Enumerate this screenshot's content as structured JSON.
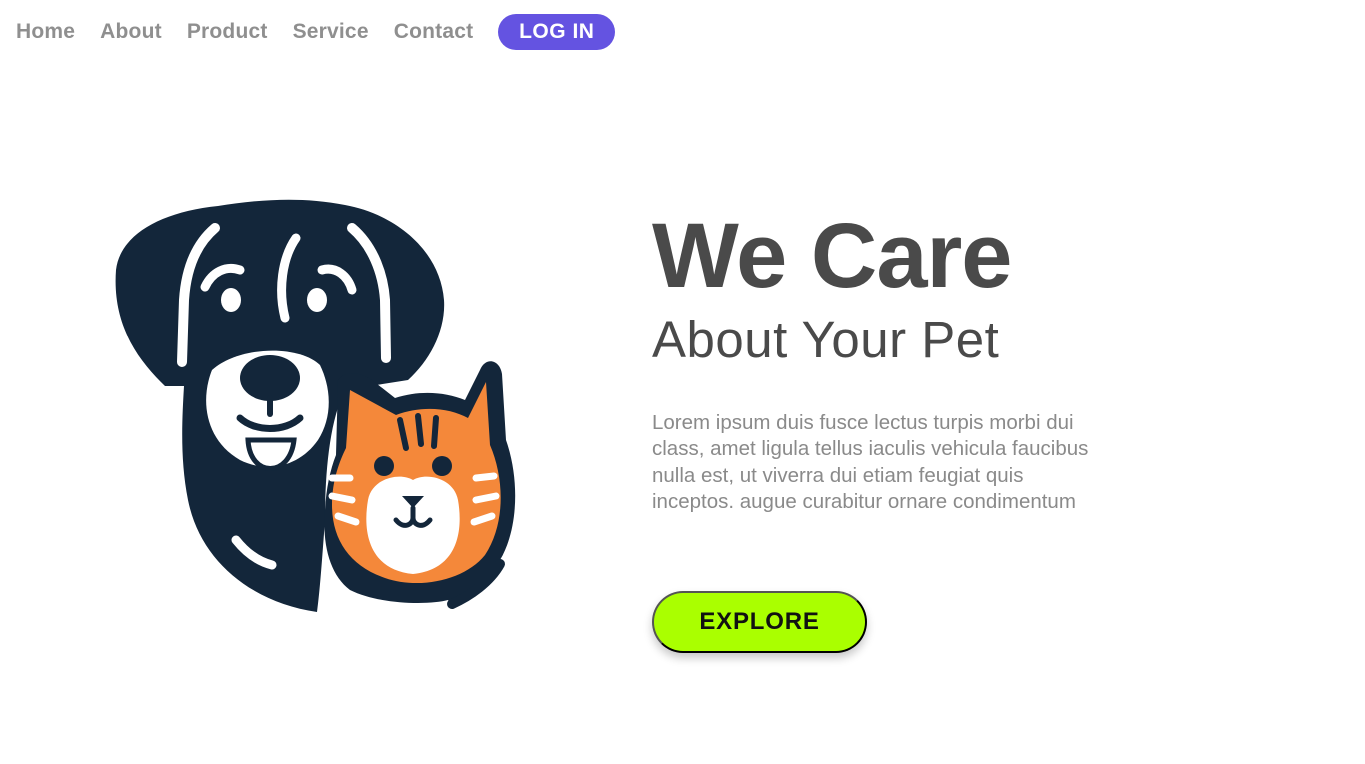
{
  "nav": {
    "links": [
      "Home",
      "About",
      "Product",
      "Service",
      "Contact"
    ],
    "login_label": "LOG IN"
  },
  "hero": {
    "headline": "We Care",
    "subheadline": "About Your Pet",
    "body": "Lorem ipsum duis fusce lectus turpis morbi dui class, amet ligula tellus iaculis vehicula faucibus nulla est, ut viverra dui etiam feugiat quis inceptos. augue curabitur ornare condimentum",
    "cta_label": "EXPLORE",
    "illustration_icon": "dog-and-cat-icon"
  },
  "colors": {
    "accent_purple": "#6453e1",
    "cta_green": "#aaff00",
    "heading_gray": "#4a4a4a",
    "body_gray": "#8a8a8a",
    "nav_gray": "#8f8f8f",
    "dog_navy": "#13263a",
    "cat_orange": "#f4883a"
  }
}
